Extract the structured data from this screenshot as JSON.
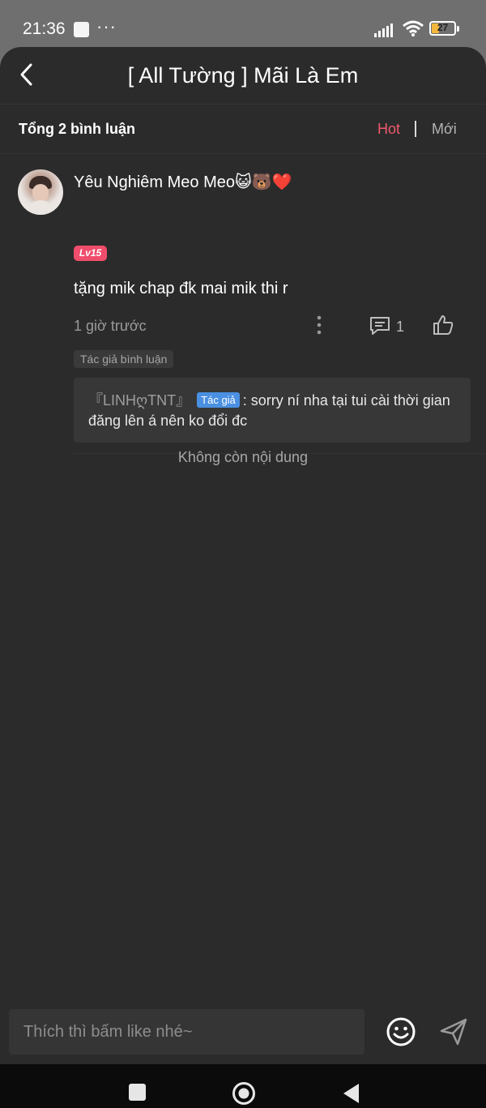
{
  "status_bar": {
    "time": "21:36",
    "dots": "···",
    "battery": "27"
  },
  "header": {
    "title": "[ All Tường ] Mãi Là Em"
  },
  "subbar": {
    "total_label": "Tổng 2 bình luận",
    "sort_hot": "Hot",
    "sort_new": "Mới",
    "active_sort_color": "#f0596b"
  },
  "comment": {
    "username": "Yêu Nghiêm Meo Meo😺🐻❤️",
    "level": "Lv15",
    "text": "tặng mik chap đk mai mik thi r",
    "time_ago": "1 giờ trước",
    "reply_count": "1",
    "author_tag": "Tác giả bình luận",
    "reply": {
      "name": "『LINHღTNT』",
      "badge": "Tác giả",
      "text": ": sorry ní nha tại tui cài thời gian đăng lên á nên ko đổi đc"
    }
  },
  "end_text": "Không còn nội dung",
  "input": {
    "placeholder": "Thích thì bấm like nhé~"
  },
  "icons": {
    "back": "back-arrow-icon",
    "more": "more-vertical-icon",
    "reply": "comment-icon",
    "like": "thumbs-up-icon",
    "emoji": "smiley-icon",
    "send": "send-icon"
  }
}
